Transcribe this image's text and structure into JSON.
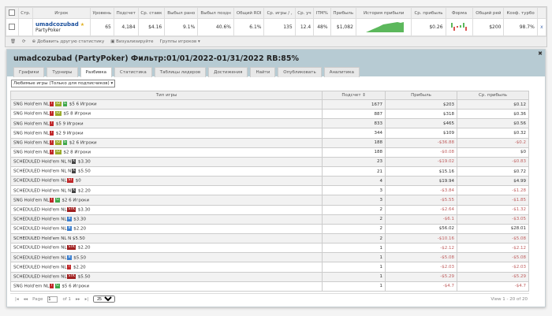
{
  "stats": {
    "headers": [
      "Стр.",
      "Игрок",
      "Уровень",
      "Подсчет",
      "Ср. ставк",
      "Выбыл рано",
      "Выбыл поздн",
      "Общий ROI",
      "Ср. игры / ,",
      "Ср. уч",
      "ITM%",
      "Прибыль",
      "История прибыли",
      "Ср. прибыль",
      "Форма",
      "Общий рей",
      "Коэф. турбо"
    ],
    "player": "umadcozubad",
    "site": "PartyPoker",
    "values": [
      "65",
      "4,184",
      "$4.16",
      "9.1%",
      "40.6%",
      "6.1%",
      "135",
      "12.4",
      "48%",
      "$1,082"
    ],
    "avg_profit": "$0.26",
    "total_buyin": "$200",
    "turbo": "98.7%",
    "remove": "x",
    "toolbar": {
      "add": "Добавить другую статистику",
      "visualize": "Визуализируйте",
      "groups": "Группы игроков ▾"
    }
  },
  "panel": {
    "title": "umadcozubad (PartyPoker) Фильтр:01/01/2022-01/31/2022 RB:85%",
    "tabs": [
      "Графики",
      "Турниры",
      "Разбивка",
      "Статистика",
      "Таблицы лидеров",
      "Достижения",
      "Найти",
      "Опубликовать",
      "Аналитика"
    ],
    "active_tab": "Разбивка",
    "select": "Любимые игры (Только для подписчиков)",
    "columns": [
      "Тип игры",
      "Подсчет ⇕",
      "Прибыль",
      "Ср. прибыль"
    ],
    "rows": [
      {
        "type": "SNG Hold'em NL",
        "badges": [
          "T",
          "x2",
          "G"
        ],
        "desc": "$5 6 Игроки",
        "count": "1677",
        "profit": "$203",
        "avg": "$0.12"
      },
      {
        "type": "SNG Hold'em NL",
        "badges": [
          "T",
          "x2"
        ],
        "desc": "$5 8 Игроки",
        "count": "887",
        "profit": "$318",
        "avg": "$0.36"
      },
      {
        "type": "SNG Hold'em NL",
        "badges": [
          "T"
        ],
        "desc": "$5 9 Игроки",
        "count": "833",
        "profit": "$465",
        "avg": "$0.56"
      },
      {
        "type": "SNG Hold'em NL",
        "badges": [
          "T"
        ],
        "desc": "$2 9 Игроки",
        "count": "344",
        "profit": "$109",
        "avg": "$0.32"
      },
      {
        "type": "SNG Hold'em NL",
        "badges": [
          "T",
          "x2",
          "G"
        ],
        "desc": "$2 6 Игроки",
        "count": "188",
        "profit": "-$36.88",
        "avg": "-$0.2"
      },
      {
        "type": "SNG Hold'em NL",
        "badges": [
          "T",
          "x2"
        ],
        "desc": "$2 8 Игроки",
        "count": "188",
        "profit": "-$0.08",
        "avg": "$0"
      },
      {
        "type": "SCHEDULED Hold'em NL N",
        "badges": [
          "K"
        ],
        "desc": "$3.30",
        "count": "23",
        "profit": "-$19.02",
        "avg": "-$0.83"
      },
      {
        "type": "SCHEDULED Hold'em NL N",
        "badges": [
          "K"
        ],
        "desc": "$5.50",
        "count": "21",
        "profit": "$15.16",
        "avg": "$0.72"
      },
      {
        "type": "SCHEDULED Hold'em NL",
        "badges": [
          "ST"
        ],
        "desc": "$0",
        "count": "4",
        "profit": "$19.94",
        "avg": "$4.99"
      },
      {
        "type": "SCHEDULED Hold'em NL N",
        "badges": [
          "K"
        ],
        "desc": "$2.20",
        "count": "3",
        "profit": "-$3.84",
        "avg": "-$1.28"
      },
      {
        "type": "SNG Hold'em NL",
        "badges": [
          "T",
          "G"
        ],
        "desc": "$2 6 Игроки",
        "count": "3",
        "profit": "-$5.55",
        "avg": "-$1.85"
      },
      {
        "type": "SCHEDULED Hold'em NL",
        "badges": [
          "STK"
        ],
        "desc": "$3.30",
        "count": "2",
        "profit": "-$2.64",
        "avg": "-$1.32"
      },
      {
        "type": "SCHEDULED Hold'em NL",
        "badges": [
          "B"
        ],
        "desc": "$3.30",
        "count": "2",
        "profit": "-$6.1",
        "avg": "-$3.05"
      },
      {
        "type": "SCHEDULED Hold'em NL",
        "badges": [
          "B"
        ],
        "desc": "$2.20",
        "count": "2",
        "profit": "$56.02",
        "avg": "$28.01"
      },
      {
        "type": "SCHEDULED Hold'em NL N",
        "badges": [],
        "desc": "$5.50",
        "count": "2",
        "profit": "-$10.16",
        "avg": "-$5.08"
      },
      {
        "type": "SCHEDULED Hold'em NL",
        "badges": [
          "STK"
        ],
        "desc": "$2.20",
        "count": "1",
        "profit": "-$2.12",
        "avg": "-$2.12"
      },
      {
        "type": "SCHEDULED Hold'em NL",
        "badges": [
          "B"
        ],
        "desc": "$5.50",
        "count": "1",
        "profit": "-$5.08",
        "avg": "-$5.08"
      },
      {
        "type": "SCHEDULED Hold'em NL",
        "badges": [
          "T"
        ],
        "desc": "$2.20",
        "count": "1",
        "profit": "-$2.03",
        "avg": "-$2.03"
      },
      {
        "type": "SCHEDULED Hold'em NL",
        "badges": [
          "STK"
        ],
        "desc": "$5.50",
        "count": "1",
        "profit": "-$5.29",
        "avg": "-$5.29"
      },
      {
        "type": "SNG Hold'em NL",
        "badges": [
          "T",
          "G"
        ],
        "desc": "$5 6 Игроки",
        "count": "1",
        "profit": "-$4.7",
        "avg": "-$4.7"
      }
    ],
    "pager": {
      "page_label": "Page",
      "page": "1",
      "of": "of 1",
      "per_page": "25",
      "view": "View 1 - 20 of 20"
    }
  },
  "colors": {
    "T": "#c0282a",
    "x2": "#9aaa2a",
    "G": "#3fa84a",
    "K": "#444444",
    "ST": "#c0282a",
    "STK": "#a02020",
    "B": "#3a7fd0"
  }
}
